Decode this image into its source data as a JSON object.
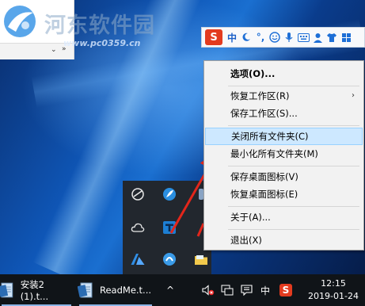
{
  "watermark": {
    "site_name": "河东软件园",
    "url": "www.pc0359.cn"
  },
  "ime_bar": {
    "logo": "S",
    "mode_label": "中",
    "icons": [
      "moon-icon",
      "punctuation-icon",
      "emoji-icon",
      "microphone-icon",
      "keyboard-icon",
      "user-icon",
      "skin-shirt-icon",
      "toolbox-icon"
    ]
  },
  "context_menu": {
    "items": [
      {
        "label": "选项(O)...",
        "bold": true
      },
      {
        "label": "恢复工作区(R)",
        "submenu": true
      },
      {
        "label": "保存工作区(S)..."
      },
      {
        "label": "关闭所有文件夹(C)",
        "highlighted": true
      },
      {
        "label": "最小化所有文件夹(M)"
      },
      {
        "label": "保存桌面图标(V)"
      },
      {
        "label": "恢复桌面图标(E)"
      },
      {
        "label": "关于(A)..."
      },
      {
        "label": "退出(X)"
      }
    ],
    "submenu_arrow": "›"
  },
  "tray_popup": {
    "icons": [
      "network-monitor-icon",
      "feather-icon",
      "cloud-icon",
      "qttabbar-t-icon",
      "azure-a-icon",
      "app-circle-icon",
      "folder-icon"
    ]
  },
  "taskbar": {
    "items": [
      {
        "label": "安装2 (1).t..."
      },
      {
        "label": "ReadMe.t..."
      }
    ],
    "tray_expand": "^",
    "ime_label": "中",
    "ime_logo": "S",
    "clock_time": "12:15",
    "clock_date": "2019-01-24"
  }
}
